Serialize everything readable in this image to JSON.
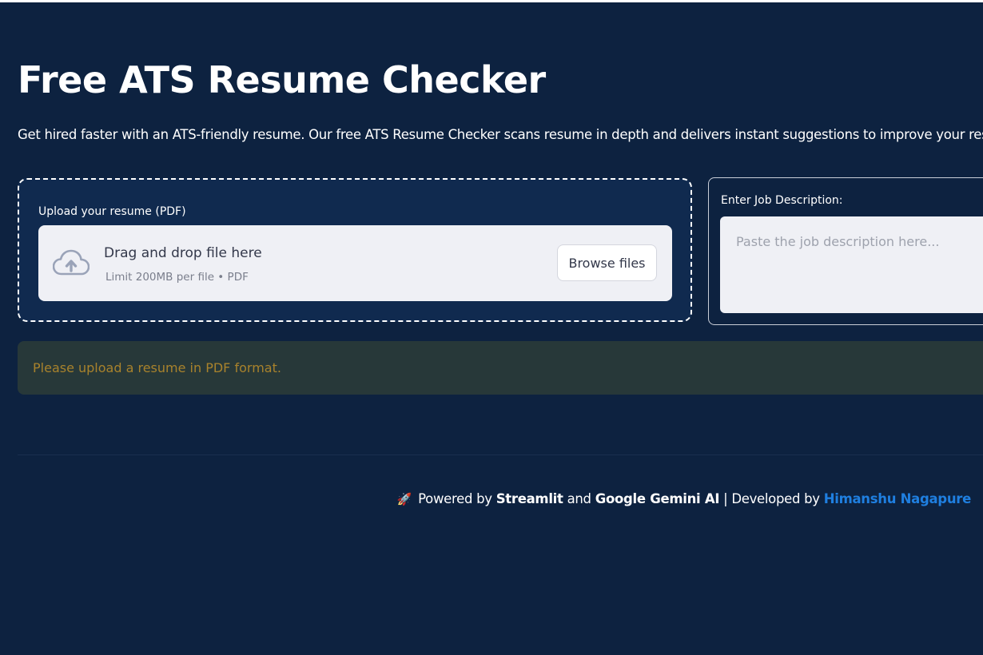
{
  "page": {
    "title": "Free ATS Resume Checker",
    "subtitle": "Get hired faster with an ATS-friendly resume. Our free ATS Resume Checker scans resume in depth and delivers instant suggestions to improve your resume."
  },
  "uploader": {
    "label": "Upload your resume (PDF)",
    "drop_title": "Drag and drop file here",
    "drop_limit": "Limit 200MB per file • PDF",
    "browse_label": "Browse files",
    "icon": "cloud-upload-icon"
  },
  "job_description": {
    "label": "Enter Job Description:",
    "placeholder": "Paste the job description here...",
    "value": ""
  },
  "alert": {
    "text": "Please upload a resume in PDF format."
  },
  "footer": {
    "rocket": "🚀",
    "prefix": "Powered by",
    "streamlit": "Streamlit",
    "and": "and",
    "gemini": "Google Gemini AI",
    "separator": "| Developed by",
    "author": "Himanshu Nagapure"
  },
  "colors": {
    "background": "#0d2240",
    "card": "#102a4f",
    "input": "#eff0f5",
    "warning_bg": "#273839",
    "warning_text": "#a8822c",
    "link": "#1f7fe0"
  }
}
